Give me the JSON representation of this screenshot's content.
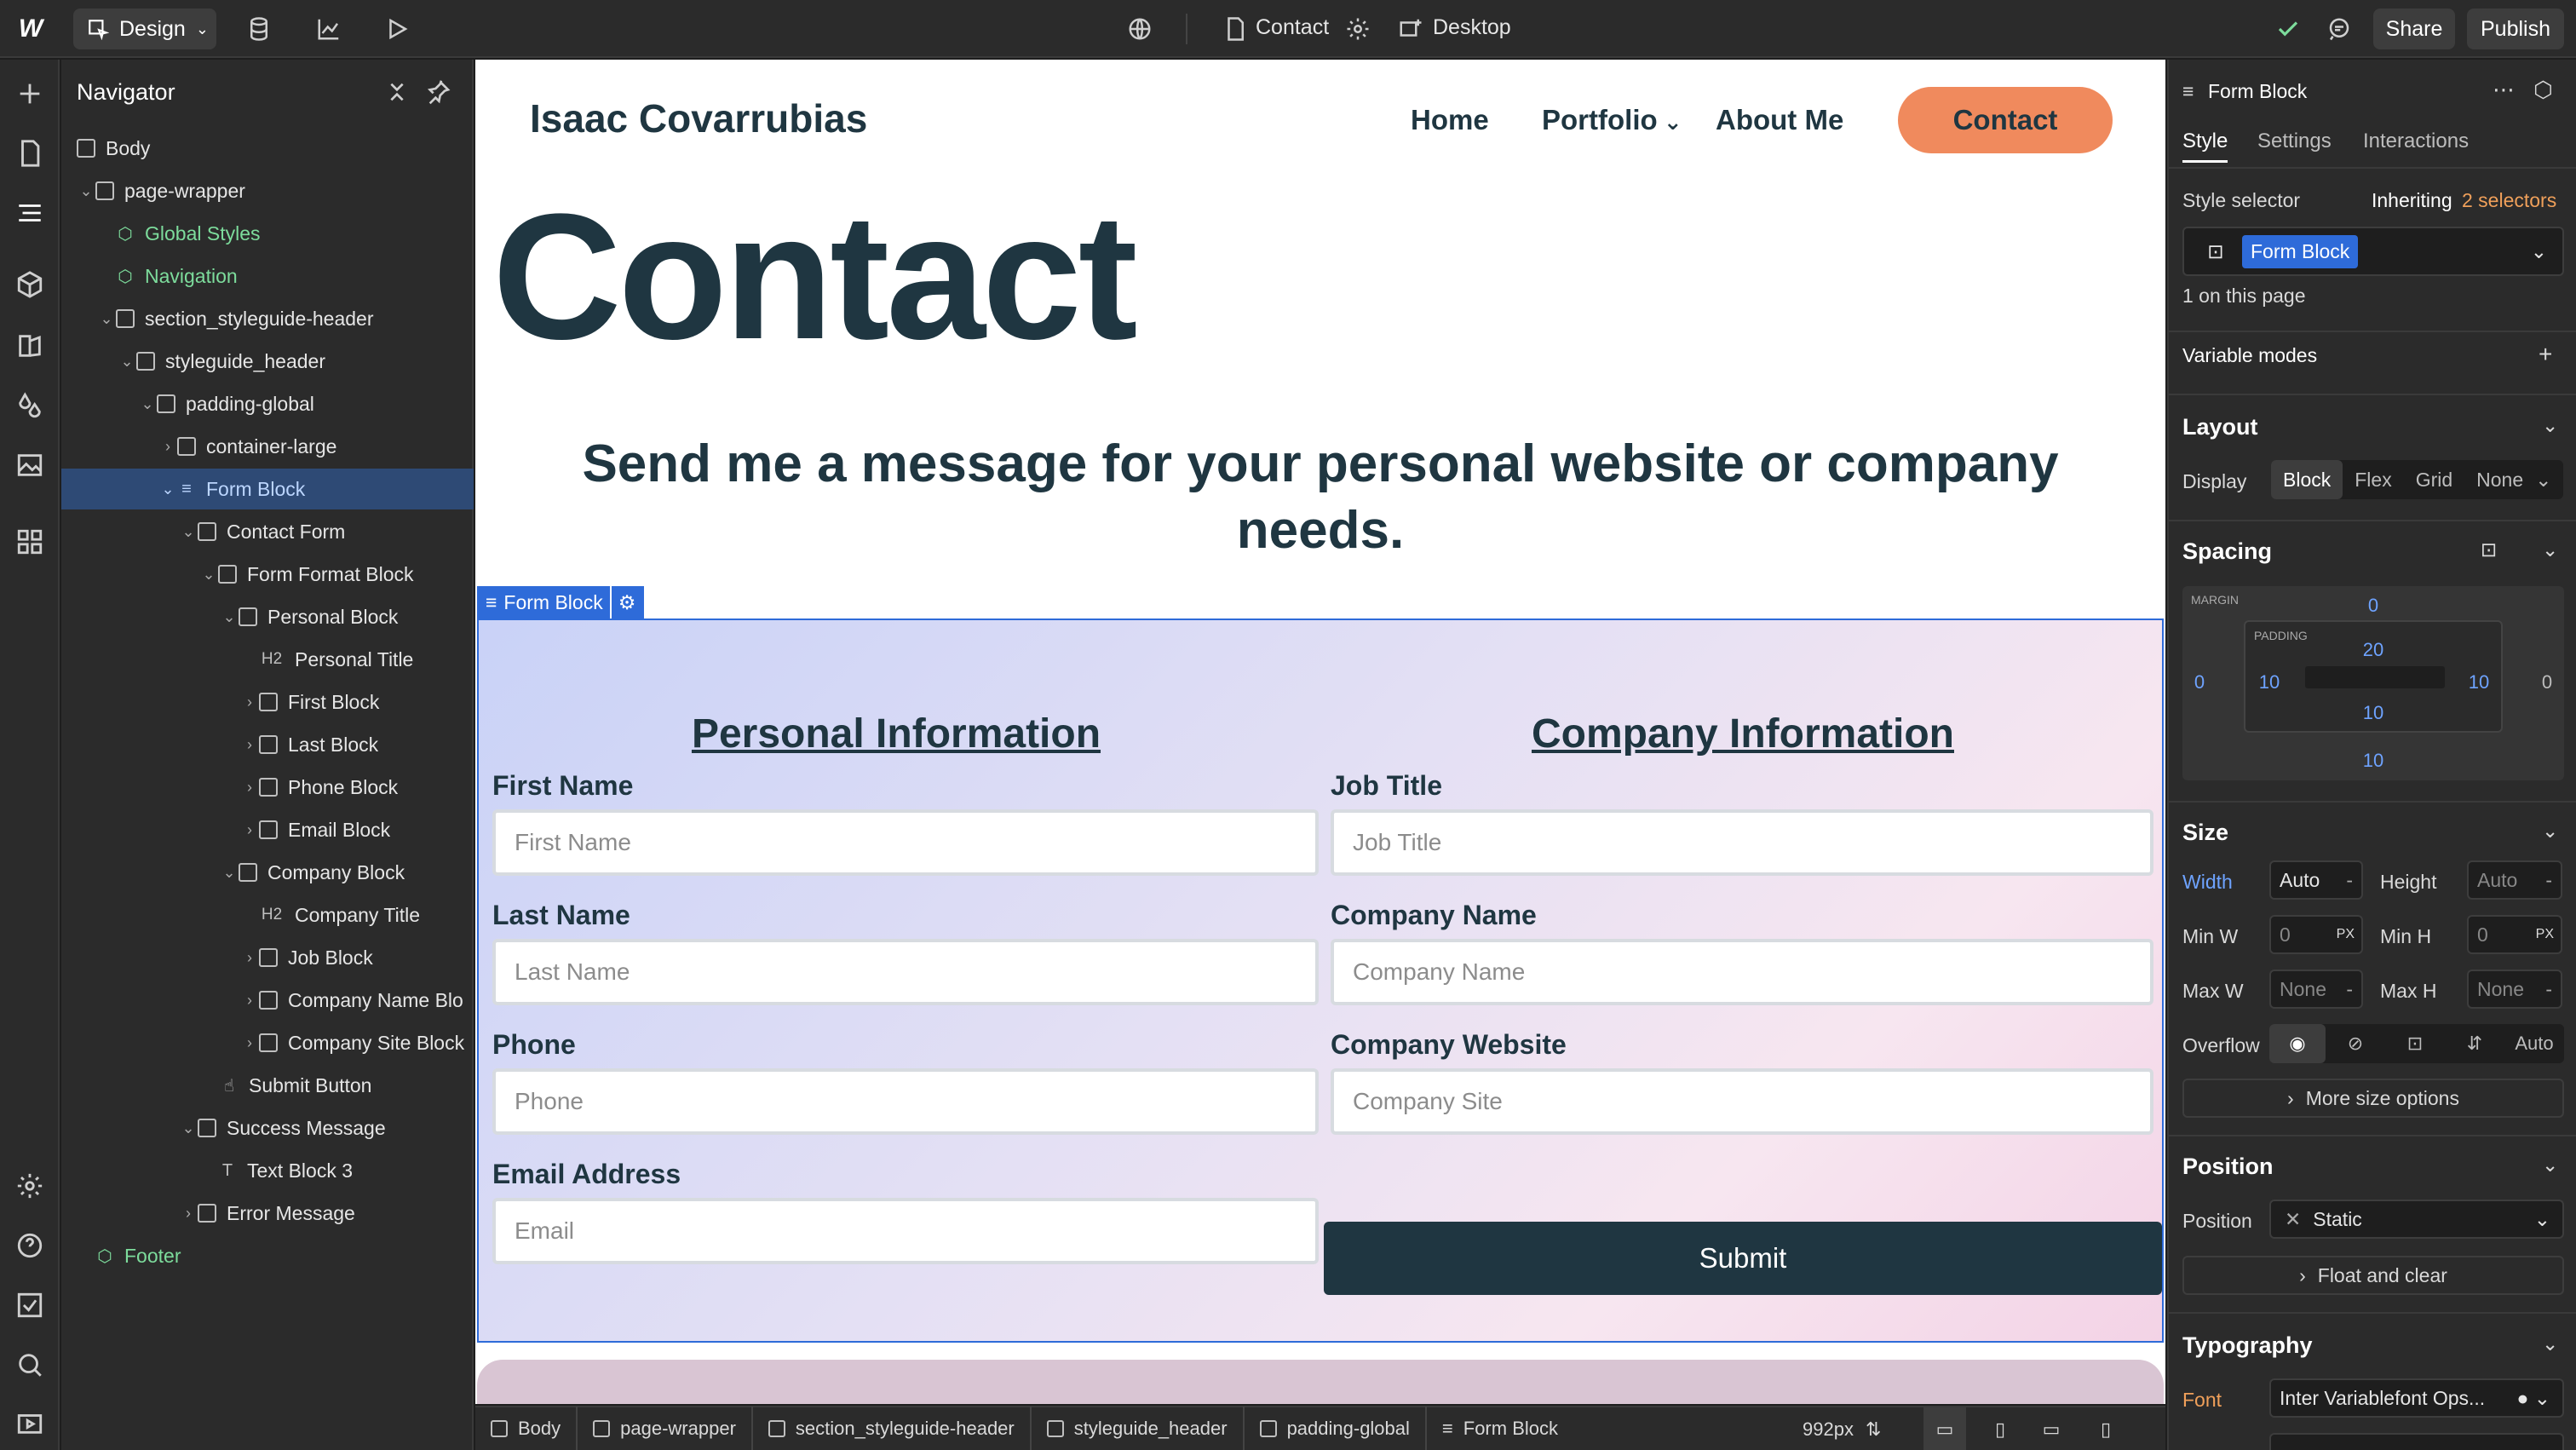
{
  "topbar": {
    "mode_label": "Design",
    "page_name": "Contact",
    "breakpoint": "Desktop",
    "share_label": "Share",
    "publish_label": "Publish"
  },
  "navigator": {
    "title": "Navigator",
    "items": [
      {
        "label": "Body"
      },
      {
        "label": "page-wrapper"
      },
      {
        "label": "Global Styles"
      },
      {
        "label": "Navigation"
      },
      {
        "label": "section_styleguide-header"
      },
      {
        "label": "styleguide_header"
      },
      {
        "label": "padding-global"
      },
      {
        "label": "container-large"
      },
      {
        "label": "Form Block"
      },
      {
        "label": "Contact Form"
      },
      {
        "label": "Form Format Block"
      },
      {
        "label": "Personal Block"
      },
      {
        "label": "Personal Title",
        "tag": "H2"
      },
      {
        "label": "First Block"
      },
      {
        "label": "Last Block"
      },
      {
        "label": "Phone Block"
      },
      {
        "label": "Email Block"
      },
      {
        "label": "Company Block"
      },
      {
        "label": "Company Title",
        "tag": "H2"
      },
      {
        "label": "Job Block"
      },
      {
        "label": "Company Name Blo"
      },
      {
        "label": "Company Site Block"
      },
      {
        "label": "Submit Button"
      },
      {
        "label": "Success Message"
      },
      {
        "label": "Text Block 3",
        "tag": "T"
      },
      {
        "label": "Error Message"
      },
      {
        "label": "Footer"
      }
    ]
  },
  "site": {
    "brand": "Isaac Covarrubias",
    "nav": {
      "home": "Home",
      "portfolio": "Portfolio",
      "about": "About Me",
      "contact": "Contact"
    },
    "hero_title": "Contact",
    "hero_sub": "Send me a message for your personal website or company needs.",
    "form_tag": "Form Block",
    "personal_heading": "Personal Information",
    "company_heading": "Company Information",
    "fields": {
      "first_label": "First Name",
      "first_placeholder": "First Name",
      "last_label": "Last Name",
      "last_placeholder": "Last Name",
      "phone_label": "Phone",
      "phone_placeholder": "Phone",
      "email_label": "Email Address",
      "email_placeholder": "Email",
      "job_label": "Job Title",
      "job_placeholder": "Job Title",
      "company_label": "Company Name",
      "company_placeholder": "Company Name",
      "website_label": "Company Website",
      "website_placeholder": "Company Site"
    },
    "submit_label": "Submit"
  },
  "breadcrumb": {
    "items": [
      "Body",
      "page-wrapper",
      "section_styleguide-header",
      "styleguide_header",
      "padding-global",
      "Form Block"
    ],
    "width_readout": "992px"
  },
  "right_panel": {
    "element_name": "Form Block",
    "tabs": [
      "Style",
      "Settings",
      "Interactions"
    ],
    "style_selector_label": "Style selector",
    "inheriting_prefix": "Inheriting",
    "inheriting_link": "2 selectors",
    "selector_chip": "Form Block",
    "on_page": "1 on this page",
    "variable_modes": "Variable modes",
    "layout": {
      "heading": "Layout",
      "display_label": "Display",
      "options": [
        "Block",
        "Flex",
        "Grid",
        "None"
      ]
    },
    "spacing": {
      "heading": "Spacing",
      "margin_label": "MARGIN",
      "padding_label": "PADDING",
      "margin": {
        "top": "0",
        "right": "0",
        "bottom": "10",
        "left": "0"
      },
      "padding": {
        "top": "20",
        "right": "10",
        "bottom": "10",
        "left": "10"
      }
    },
    "size": {
      "heading": "Size",
      "width_label": "Width",
      "width_value": "Auto",
      "height_label": "Height",
      "height_value": "Auto",
      "minw_label": "Min W",
      "minw_value": "0",
      "minh_label": "Min H",
      "minh_value": "0",
      "unit": "PX",
      "maxw_label": "Max W",
      "maxw_value": "None",
      "maxh_label": "Max H",
      "maxh_value": "None",
      "overflow_label": "Overflow",
      "overflow_auto": "Auto",
      "more_label": "More size options"
    },
    "position": {
      "heading": "Position",
      "label": "Position",
      "value": "Static",
      "float_label": "Float and clear"
    },
    "typography": {
      "heading": "Typography",
      "font_label": "Font",
      "font_value": "Inter Variablefont Ops..."
    }
  },
  "colors": {
    "accent": "#2e6bd9",
    "brand_dark": "#1f3641",
    "contact_pill": "#f08a5d"
  }
}
